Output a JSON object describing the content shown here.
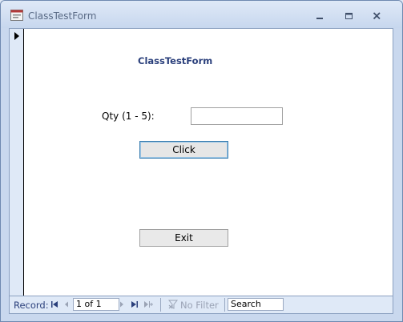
{
  "window": {
    "title": "ClassTestForm",
    "controls": [
      "minimize-icon",
      "maximize-icon",
      "close-icon"
    ]
  },
  "form": {
    "title": "ClassTestForm",
    "qty_label": "Qty (1 - 5):",
    "qty_value": "",
    "click_label": "Click",
    "exit_label": "Exit"
  },
  "navigation": {
    "record_label": "Record:",
    "counter": "1 of 1",
    "filter_label": "No Filter",
    "search_placeholder": "Search"
  },
  "colors": {
    "title_text": "#2a3f7b",
    "frame": "#c9d8ee",
    "focus_border": "#3c7fb1"
  }
}
